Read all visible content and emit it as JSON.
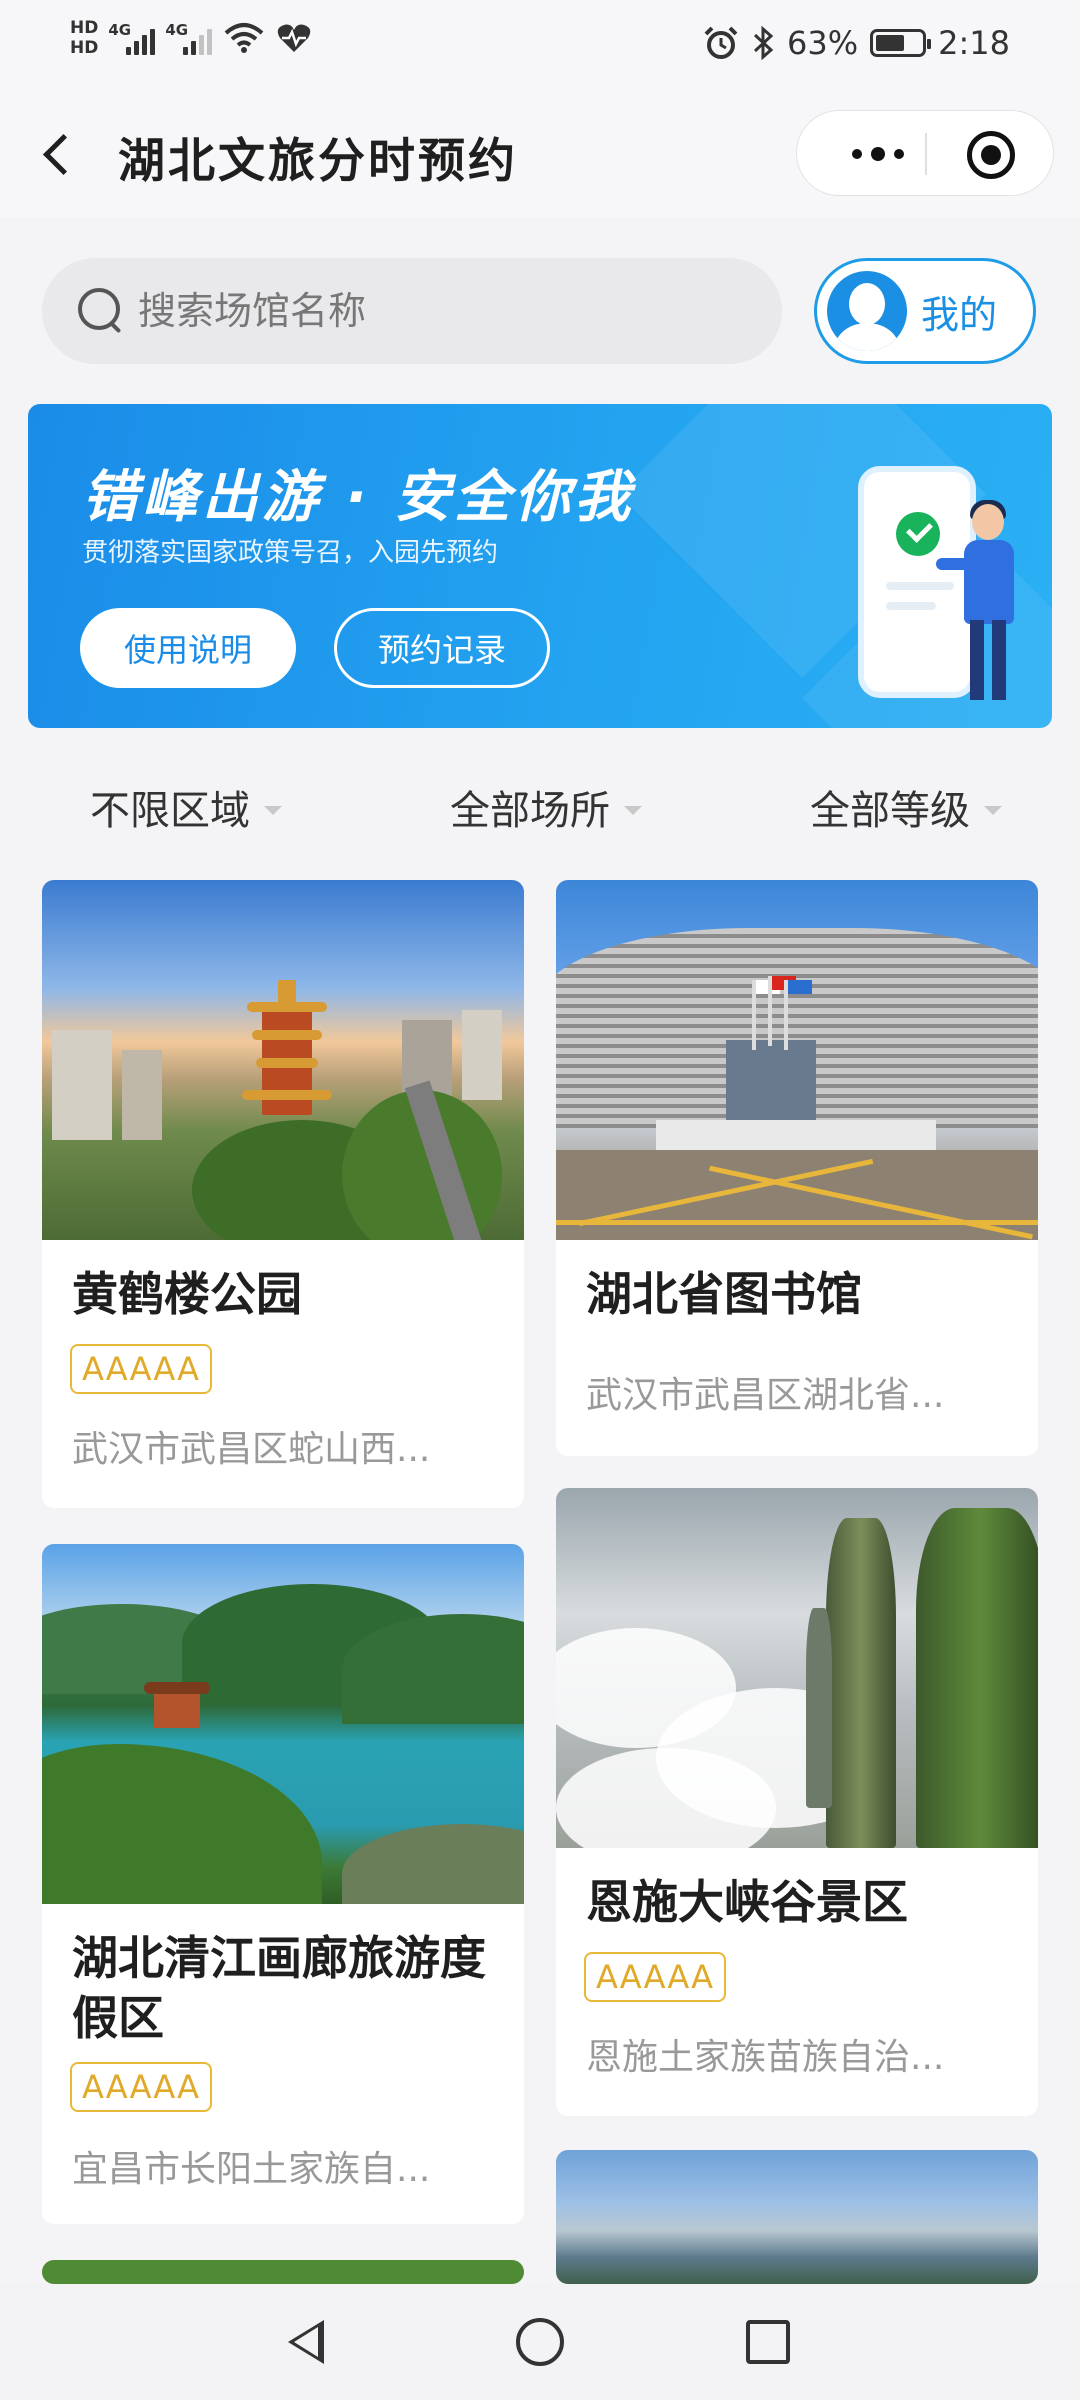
{
  "status_bar": {
    "hd1": "HD",
    "hd2": "HD",
    "sim1": "4G",
    "sim2": "4G",
    "battery": "63%",
    "battery_level": 0.63,
    "time": "2:18"
  },
  "header": {
    "title": "湖北文旅分时预约"
  },
  "search": {
    "placeholder": "搜索场馆名称",
    "mine_label": "我的"
  },
  "banner": {
    "title": "错峰出游 · 安全你我",
    "subtitle": "贯彻落实国家政策号召，入园先预约",
    "guide_button": "使用说明",
    "records_button": "预约记录"
  },
  "filters": {
    "region": "不限区域",
    "venue": "全部场所",
    "level": "全部等级"
  },
  "venues": [
    {
      "name": "黄鹤楼公园",
      "rating": "AAAAA",
      "address": "武汉市武昌区蛇山西..."
    },
    {
      "name": "湖北省图书馆",
      "rating": "",
      "address": "武汉市武昌区湖北省..."
    },
    {
      "name": "湖北清江画廊旅游度假区",
      "rating": "AAAAA",
      "address": "宜昌市长阳土家族自..."
    },
    {
      "name": "恩施大峡谷景区",
      "rating": "AAAAA",
      "address": "恩施土家族苗族自治..."
    }
  ],
  "icons": {
    "back": "chevron-left-icon",
    "more": "more-dots-icon",
    "close": "target-close-icon",
    "search": "search-icon",
    "avatar": "user-avatar-icon",
    "caret": "caret-down-icon"
  },
  "colors": {
    "accent": "#1a8ce8",
    "rating": "#e0a92a"
  }
}
